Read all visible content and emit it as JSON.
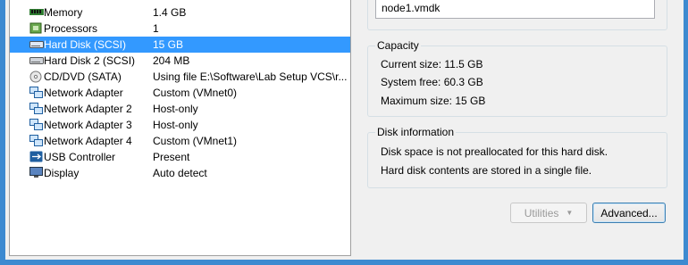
{
  "devices": [
    {
      "name": "Memory",
      "summary": "1.4 GB",
      "icon": "memory-icon"
    },
    {
      "name": "Processors",
      "summary": "1",
      "icon": "processor-icon"
    },
    {
      "name": "Hard Disk (SCSI)",
      "summary": "15 GB",
      "icon": "hard-disk-icon",
      "selected": true
    },
    {
      "name": "Hard Disk 2 (SCSI)",
      "summary": "204 MB",
      "icon": "hard-disk-icon"
    },
    {
      "name": "CD/DVD (SATA)",
      "summary": "Using file E:\\Software\\Lab Setup VCS\\r...",
      "icon": "cd-dvd-icon"
    },
    {
      "name": "Network Adapter",
      "summary": "Custom (VMnet0)",
      "icon": "network-adapter-icon"
    },
    {
      "name": "Network Adapter 2",
      "summary": "Host-only",
      "icon": "network-adapter-icon"
    },
    {
      "name": "Network Adapter 3",
      "summary": "Host-only",
      "icon": "network-adapter-icon"
    },
    {
      "name": "Network Adapter 4",
      "summary": "Custom (VMnet1)",
      "icon": "network-adapter-icon"
    },
    {
      "name": "USB Controller",
      "summary": "Present",
      "icon": "usb-icon"
    },
    {
      "name": "Display",
      "summary": "Auto detect",
      "icon": "display-icon"
    }
  ],
  "disk_file": {
    "value": "node1.vmdk"
  },
  "capacity": {
    "title": "Capacity",
    "current_size": "Current size:  11.5 GB",
    "system_free": "System free:  60.3 GB",
    "maximum_size": "Maximum size:  15 GB"
  },
  "disk_information": {
    "title": "Disk information",
    "line1": "Disk space is not preallocated for this hard disk.",
    "line2": "Hard disk contents are stored in a single file."
  },
  "buttons": {
    "utilities_label": "Utilities",
    "advanced_label": "Advanced..."
  },
  "colors": {
    "selection": "#3399ff",
    "frame": "#3d8ad0"
  }
}
